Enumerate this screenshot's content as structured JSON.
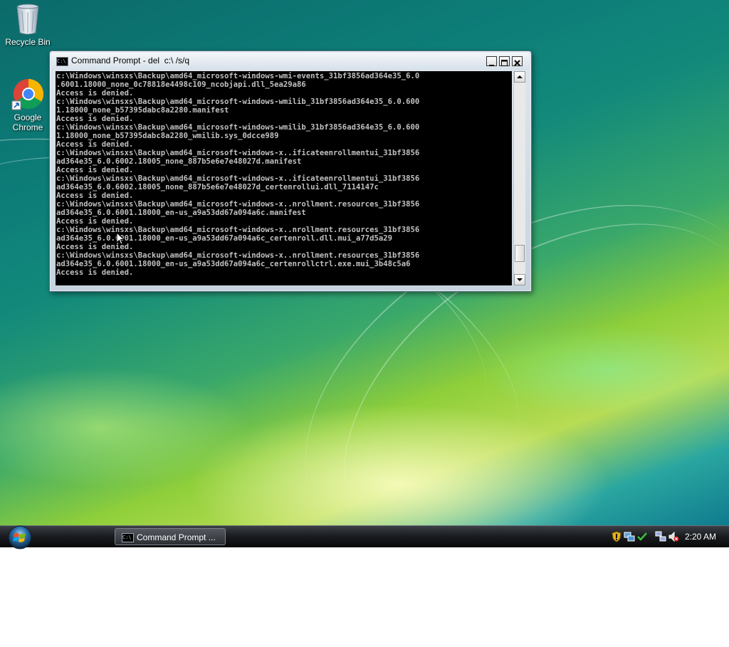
{
  "desktop": {
    "icons": [
      {
        "label": "Recycle Bin",
        "icon": "recycle-bin-icon"
      },
      {
        "label": "Google\nChrome",
        "icon": "chrome-icon"
      }
    ]
  },
  "window": {
    "title": "Command Prompt - del  c:\\ /s/q",
    "controls": [
      "minimize",
      "maximize",
      "close"
    ],
    "console_lines": [
      "c:\\Windows\\winsxs\\Backup\\amd64_microsoft-windows-wmi-events_31bf3856ad364e35_6.0",
      ".6001.18000_none_0c78818e4498c109_ncobjapi.dll_5ea29a86",
      "Access is denied.",
      "c:\\Windows\\winsxs\\Backup\\amd64_microsoft-windows-wmilib_31bf3856ad364e35_6.0.600",
      "1.18000_none_b57395dabc8a2280.manifest",
      "Access is denied.",
      "c:\\Windows\\winsxs\\Backup\\amd64_microsoft-windows-wmilib_31bf3856ad364e35_6.0.600",
      "1.18000_none_b57395dabc8a2280_wmilib.sys_0dcce989",
      "Access is denied.",
      "c:\\Windows\\winsxs\\Backup\\amd64_microsoft-windows-x..ificateenrollmentui_31bf3856",
      "ad364e35_6.0.6002.18005_none_887b5e6e7e48027d.manifest",
      "Access is denied.",
      "c:\\Windows\\winsxs\\Backup\\amd64_microsoft-windows-x..ificateenrollmentui_31bf3856",
      "ad364e35_6.0.6002.18005_none_887b5e6e7e48027d_certenrollui.dll_7114147c",
      "Access is denied.",
      "c:\\Windows\\winsxs\\Backup\\amd64_microsoft-windows-x..nrollment.resources_31bf3856",
      "ad364e35_6.0.6001.18000_en-us_a9a53dd67a094a6c.manifest",
      "Access is denied.",
      "c:\\Windows\\winsxs\\Backup\\amd64_microsoft-windows-x..nrollment.resources_31bf3856",
      "ad364e35_6.0.6001.18000_en-us_a9a53dd67a094a6c_certenroll.dll.mui_a77d5a29",
      "Access is denied.",
      "c:\\Windows\\winsxs\\Backup\\amd64_microsoft-windows-x..nrollment.resources_31bf3856",
      "ad364e35_6.0.6001.18000_en-us_a9a53dd67a094a6c_certenrollctrl.exe.mui_3b48c5a6",
      "Access is denied."
    ],
    "scroll_position": 0.93
  },
  "taskbar": {
    "task_button_label": "Command Prompt ...",
    "tray_icons": [
      "shield-warning-icon",
      "network-icon",
      "checkmark-icon",
      "network-computers-icon",
      "speaker-muted-icon"
    ],
    "clock": "2:20 AM"
  },
  "colors": {
    "console_bg": "#000000",
    "console_fg": "#c0c0c0",
    "taskbar_bg": "#1b1d21"
  }
}
